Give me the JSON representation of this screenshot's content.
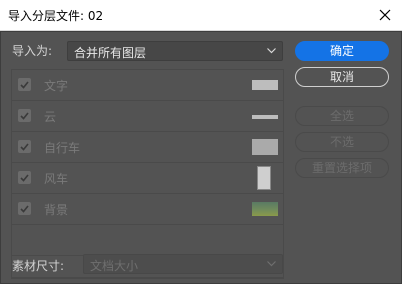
{
  "window": {
    "title": "导入分层文件: 02",
    "close_icon": "close-icon"
  },
  "import_as": {
    "label": "导入为:",
    "value": "合并所有图层"
  },
  "layers": [
    {
      "name": "文字",
      "checked": true,
      "thumb": "thumb-text"
    },
    {
      "name": "云",
      "checked": true,
      "thumb": "thumb-cloud"
    },
    {
      "name": "自行车",
      "checked": true,
      "thumb": "thumb-bicycle"
    },
    {
      "name": "风车",
      "checked": true,
      "thumb": "thumb-windmill"
    },
    {
      "name": "背景",
      "checked": true,
      "thumb": "thumb-background"
    }
  ],
  "buttons": {
    "ok": "确定",
    "cancel": "取消",
    "select_all": "全选",
    "deselect": "不选",
    "reset": "重置选择项"
  },
  "footage_size": {
    "label": "素材尺寸:",
    "value": "文档大小"
  },
  "colors": {
    "accent": "#1473e6",
    "panel": "#535353"
  }
}
